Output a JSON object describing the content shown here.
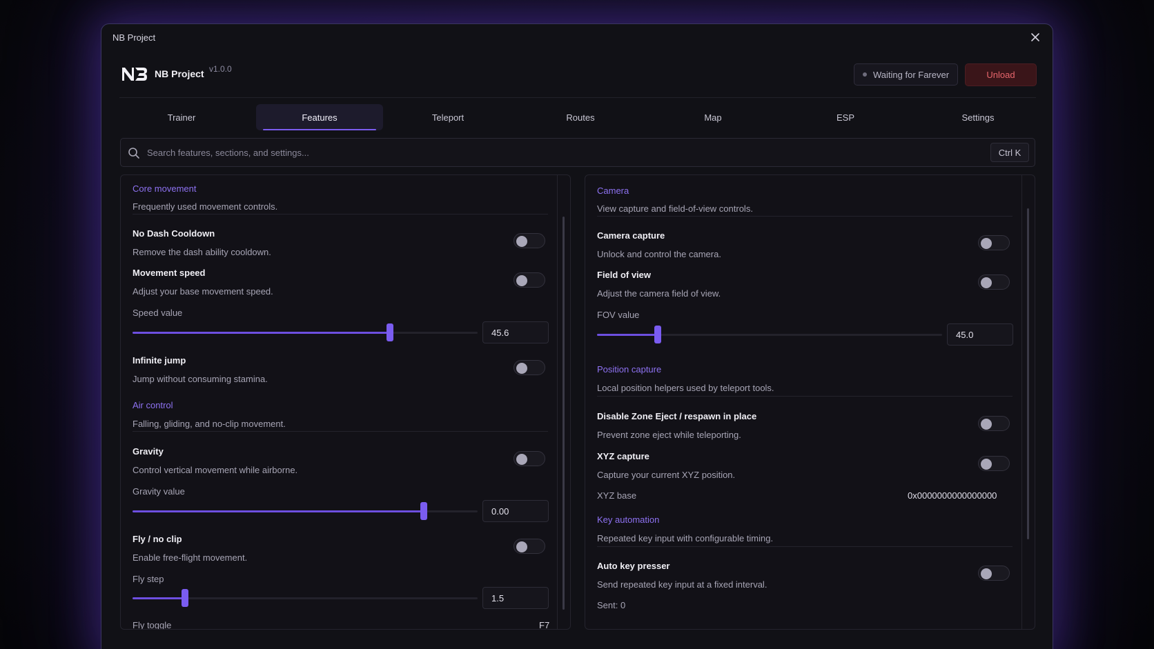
{
  "window": {
    "title": "NB Project"
  },
  "header": {
    "app_name": "NB Project",
    "version": "v1.0.0",
    "status_text": "Waiting for Farever",
    "unload_label": "Unload"
  },
  "tabs": [
    {
      "label": "Trainer"
    },
    {
      "label": "Features",
      "active": true
    },
    {
      "label": "Teleport"
    },
    {
      "label": "Routes"
    },
    {
      "label": "Map"
    },
    {
      "label": "ESP"
    },
    {
      "label": "Settings"
    }
  ],
  "search": {
    "placeholder": "Search features, sections, and settings...",
    "shortcut": "Ctrl K"
  },
  "left": {
    "core": {
      "title": "Core movement",
      "desc": "Frequently used movement controls.",
      "no_dash": {
        "title": "No Dash Cooldown",
        "desc": "Remove the dash ability cooldown.",
        "on": false
      },
      "movement_speed": {
        "title": "Movement speed",
        "desc": "Adjust your base movement speed.",
        "on": false,
        "sub_label": "Speed value",
        "value": "45.6",
        "fill": 0.745
      },
      "infinite_jump": {
        "title": "Infinite jump",
        "desc": "Jump without consuming stamina.",
        "on": false
      }
    },
    "air": {
      "title": "Air control",
      "desc": "Falling, gliding, and no-clip movement.",
      "gravity": {
        "title": "Gravity",
        "desc": "Control vertical movement while airborne.",
        "on": false,
        "sub_label": "Gravity value",
        "value": "0.00",
        "fill": 0.843
      },
      "fly": {
        "title": "Fly / no clip",
        "desc": "Enable free-flight movement.",
        "on": false,
        "sub_label": "Fly step",
        "value": "1.5",
        "fill": 0.152
      },
      "fly_toggle": {
        "label": "Fly toggle",
        "key": "F7"
      }
    }
  },
  "right": {
    "camera": {
      "title": "Camera",
      "desc": "View capture and field-of-view controls.",
      "capture": {
        "title": "Camera capture",
        "desc": "Unlock and control the camera.",
        "on": false
      },
      "fov": {
        "title": "Field of view",
        "desc": "Adjust the camera field of view.",
        "on": false,
        "sub_label": "FOV value",
        "value": "45.0",
        "fill": 0.176
      }
    },
    "position": {
      "title": "Position capture",
      "desc": "Local position helpers used by teleport tools.",
      "zone_eject": {
        "title": "Disable Zone Eject / respawn in place",
        "desc": "Prevent zone eject while teleporting.",
        "on": false
      },
      "xyz": {
        "title": "XYZ capture",
        "desc": "Capture your current XYZ position.",
        "on": false
      },
      "xyz_base": {
        "label": "XYZ base",
        "value": "0x0000000000000000"
      }
    },
    "keys": {
      "title": "Key automation",
      "desc": "Repeated key input with configurable timing.",
      "auto_key": {
        "title": "Auto key presser",
        "desc": "Send repeated key input at a fixed interval.",
        "on": false
      },
      "sent": "Sent: 0"
    }
  },
  "colors": {
    "accent": "#7b5cf0",
    "danger": "#e8666c",
    "background": "#111116"
  }
}
